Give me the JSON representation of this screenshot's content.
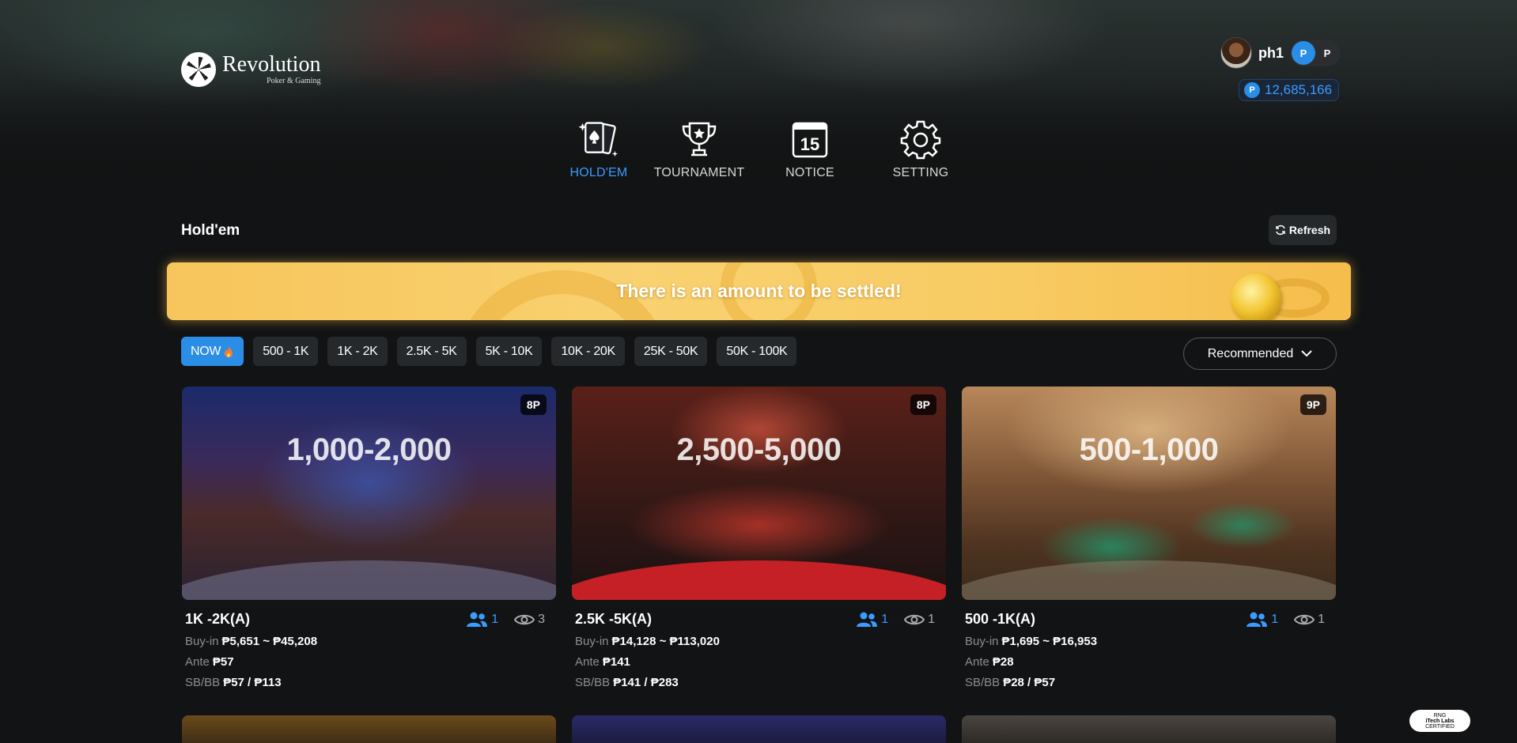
{
  "brand": {
    "name": "Revolution",
    "tagline": "Poker & Gaming"
  },
  "user": {
    "name": "ph1",
    "currency_active": "P",
    "currency_other": "P",
    "balance": "12,685,166",
    "balance_icon": "P"
  },
  "nav": [
    {
      "label": "HOLD'EM",
      "icon": "cards-spade-icon",
      "active": true
    },
    {
      "label": "TOURNAMENT",
      "icon": "trophy-icon",
      "active": false
    },
    {
      "label": "NOTICE",
      "icon": "calendar-icon",
      "calendar_day": "15",
      "active": false
    },
    {
      "label": "SETTING",
      "icon": "gear-icon",
      "active": false
    }
  ],
  "section": {
    "title": "Hold'em",
    "refresh_label": "Refresh"
  },
  "banner": {
    "text": "There is an amount to be settled!"
  },
  "filters": {
    "now_label": "NOW",
    "ranges": [
      "500 - 1K",
      "1K - 2K",
      "2.5K - 5K",
      "5K - 10K",
      "10K - 20K",
      "25K - 50K",
      "50K - 100K"
    ],
    "sort_label": "Recommended"
  },
  "tables": [
    {
      "overlay": "1,000-2,000",
      "seats": "8P",
      "name": "1K -2K(A)",
      "players": "1",
      "watchers": "3",
      "buyin_label": "Buy-in",
      "buyin": "₱5,651 ~ ₱45,208",
      "ante_label": "Ante",
      "ante": "₱57",
      "blinds_label": "SB/BB",
      "blinds": "₱57 / ₱113"
    },
    {
      "overlay": "2,500-5,000",
      "seats": "8P",
      "name": "2.5K -5K(A)",
      "players": "1",
      "watchers": "1",
      "buyin_label": "Buy-in",
      "buyin": "₱14,128 ~ ₱113,020",
      "ante_label": "Ante",
      "ante": "₱141",
      "blinds_label": "SB/BB",
      "blinds": "₱141 / ₱283"
    },
    {
      "overlay": "500-1,000",
      "seats": "9P",
      "name": "500 -1K(A)",
      "players": "1",
      "watchers": "1",
      "buyin_label": "Buy-in",
      "buyin": "₱1,695 ~ ₱16,953",
      "ante_label": "Ante",
      "ante": "₱28",
      "blinds_label": "SB/BB",
      "blinds": "₱28 / ₱57"
    }
  ],
  "certification": {
    "line1": "RNG",
    "line2": "iTech Labs",
    "line3": "CERTIFIED"
  },
  "colors": {
    "accent": "#2a8de6",
    "banner": "#f8cb63",
    "background": "#121314"
  }
}
